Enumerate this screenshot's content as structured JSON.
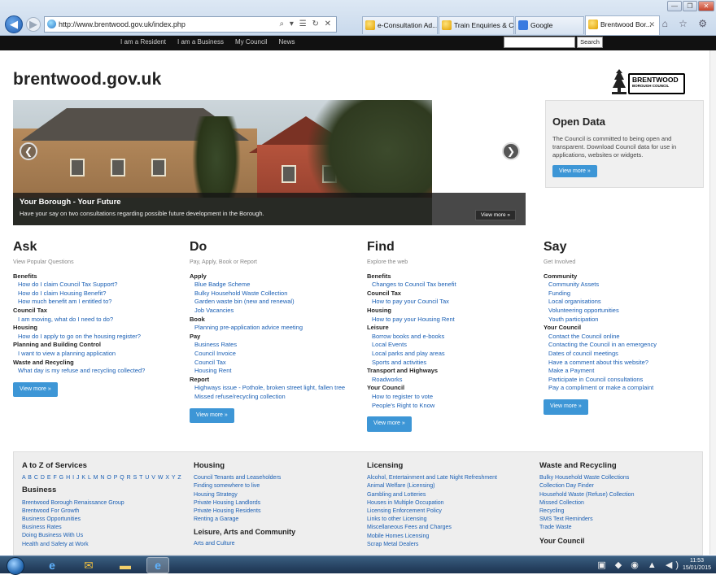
{
  "browser": {
    "url": "http://www.brentwood.gov.uk/index.php",
    "addr_controls": "⌕ ▾ ☰ ↻ ✕",
    "tabs": [
      {
        "title": "e-Consultation Ad...",
        "icon": "ie-icon"
      },
      {
        "title": "Train Enquiries & C...",
        "icon": "ie-icon"
      },
      {
        "title": "Google",
        "icon": "google-icon"
      },
      {
        "title": "Brentwood Bor...",
        "icon": "ie-icon",
        "active": true
      }
    ],
    "window_buttons": [
      "—",
      "❐",
      "✕"
    ],
    "toolbar_icons": "⌂ ☆ ⚙"
  },
  "topbar": {
    "nav": [
      "I am a Resident",
      "I am a Business",
      "My Council",
      "News"
    ],
    "search_placeholder": "",
    "search_button": "Search"
  },
  "site": {
    "title": "brentwood.gov.uk",
    "logo_line1": "BRENTWOOD",
    "logo_line2": "BOROUGH COUNCIL"
  },
  "hero": {
    "heading": "Your Borough - Your Future",
    "text": "Have your say on two consultations regarding possible future development in the Borough.",
    "button": "View more »"
  },
  "open_data": {
    "heading": "Open Data",
    "text": "The Council is committed to being open and transparent. Download Council data for use in applications, websites or widgets.",
    "button": "View more »"
  },
  "columns": [
    {
      "title": "Ask",
      "subtitle": "View Popular Questions",
      "button": "View more »",
      "groups": [
        {
          "cat": "Benefits",
          "links": [
            "How do I claim Council Tax Support?",
            "How do I claim Housing Benefit?",
            "How much benefit am I entitled to?"
          ]
        },
        {
          "cat": "Council Tax",
          "links": [
            "I am moving, what do I need to do?"
          ]
        },
        {
          "cat": "Housing",
          "links": [
            "How do I apply to go on the housing register?"
          ]
        },
        {
          "cat": "Planning and Building Control",
          "links": [
            "I want to view a planning application"
          ]
        },
        {
          "cat": "Waste and Recycling",
          "links": [
            "What day is my refuse and recycling collected?"
          ]
        }
      ]
    },
    {
      "title": "Do",
      "subtitle": "Pay, Apply, Book or Report",
      "button": "View more »",
      "groups": [
        {
          "cat": "Apply",
          "links": [
            "Blue Badge Scheme",
            "Bulky Household Waste Collection",
            "Garden waste bin (new and renewal)",
            "Job Vacancies"
          ]
        },
        {
          "cat": "Book",
          "links": [
            "Planning pre-application advice meeting"
          ]
        },
        {
          "cat": "Pay",
          "links": [
            "Business Rates",
            "Council Invoice",
            "Council Tax",
            "Housing Rent"
          ]
        },
        {
          "cat": "Report",
          "links": [
            "Highways issue - Pothole, broken street light, fallen tree",
            "Missed refuse/recycling collection"
          ]
        }
      ]
    },
    {
      "title": "Find",
      "subtitle": "Explore the web",
      "button": "View more »",
      "groups": [
        {
          "cat": "Benefits",
          "links": [
            "Changes to Council Tax benefit"
          ]
        },
        {
          "cat": "Council Tax",
          "links": [
            "How to pay your Council Tax"
          ]
        },
        {
          "cat": "Housing",
          "links": [
            "How to pay your Housing Rent"
          ]
        },
        {
          "cat": "Leisure",
          "links": [
            "Borrow books and e-books",
            "Local Events",
            "Local parks and play areas",
            "Sports and activities"
          ]
        },
        {
          "cat": "Transport and Highways",
          "links": [
            "Roadworks"
          ]
        },
        {
          "cat": "Your Council",
          "links": [
            "How to register to vote",
            "People's Right to Know"
          ]
        }
      ]
    },
    {
      "title": "Say",
      "subtitle": "Get Involved",
      "button": "View more »",
      "groups": [
        {
          "cat": "Community",
          "links": [
            "Community Assets",
            "Funding",
            "Local organisations",
            "Volunteering opportunities",
            "Youth participation"
          ]
        },
        {
          "cat": "Your Council",
          "links": [
            "Contact the Council online",
            "Contacting the Council in an emergency",
            "Dates of council meetings",
            "Have a comment about this website?",
            "Make a Payment",
            "Participate in Council consultations",
            "Pay a compliment or make a complaint"
          ]
        }
      ]
    }
  ],
  "footer": {
    "az_title": "A to Z of Services",
    "az_letters": "A B C D E F G H I J K L M N O P Q R S T U V W X Y Z",
    "business_title": "Business",
    "business_links": [
      "Brentwood Borough Renaissance Group",
      "Brentwood For Growth",
      "Business Opportunities",
      "Business Rates",
      "Doing Business With Us",
      "Health and Safety at Work"
    ],
    "housing_title": "Housing",
    "housing_links": [
      "Council Tenants and Leaseholders",
      "Finding somewhere to live",
      "Housing Strategy",
      "Private Housing Landlords",
      "Private Housing Residents",
      "Renting a Garage"
    ],
    "leisure_title": "Leisure, Arts and Community",
    "leisure_links": [
      "Arts and Culture"
    ],
    "licensing_title": "Licensing",
    "licensing_links": [
      "Alcohol, Entertainment and Late Night Refreshment",
      "Animal Welfare (Licensing)",
      "Gambling and Lotteries",
      "Houses in Multiple Occupation",
      "Licensing Enforcement Policy",
      "Links to other Licensing",
      "Miscellaneous Fees and Charges",
      "Mobile Homes Licensing",
      "Scrap Metal Dealers"
    ],
    "waste_title": "Waste and Recycling",
    "waste_links": [
      "Bulky Household Waste Collections",
      "Collection Day Finder",
      "Household Waste (Refuse) Collection",
      "Missed Collection",
      "Recycling",
      "SMS Text Reminders",
      "Trade Waste"
    ],
    "council_title": "Your Council"
  },
  "taskbar": {
    "time": "11:53",
    "date": "15/01/2015",
    "tray": "▣ ◆ ◉ ▲ ◀)"
  }
}
